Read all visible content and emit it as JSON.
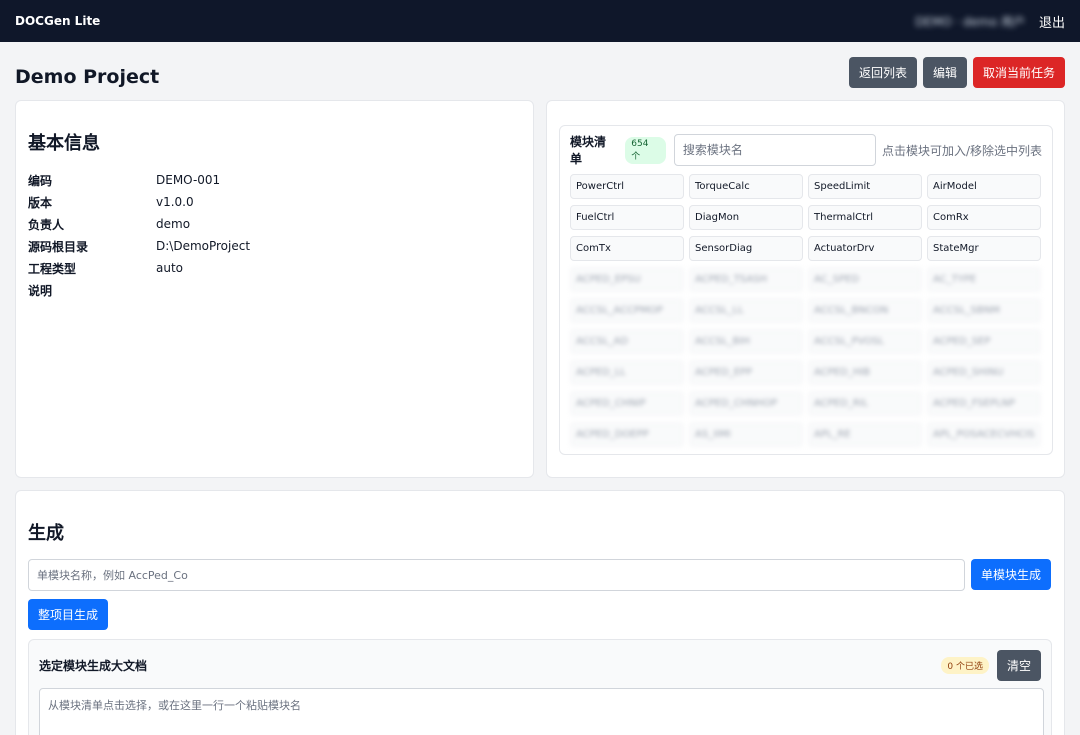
{
  "header": {
    "brand": "DOCGen Lite",
    "user": "DEMO · demo 用户",
    "logout": "退出"
  },
  "page": {
    "title": "Demo Project"
  },
  "actions": {
    "back": "返回列表",
    "edit": "编辑",
    "cancel_task": "取消当前任务"
  },
  "basic_info": {
    "title": "基本信息",
    "rows": [
      {
        "label": "编码",
        "value": "DEMO-001"
      },
      {
        "label": "版本",
        "value": "v1.0.0"
      },
      {
        "label": "负责人",
        "value": "demo"
      },
      {
        "label": "源码根目录",
        "value": "D:\\DemoProject"
      },
      {
        "label": "工程类型",
        "value": "auto"
      },
      {
        "label": "说明",
        "value": ""
      }
    ]
  },
  "modules": {
    "title": "模块清单",
    "count": "654 个",
    "search_placeholder": "搜索模块名",
    "hint": "点击模块可加入/移除选中列表",
    "items": [
      "PowerCtrl",
      "TorqueCalc",
      "SpeedLimit",
      "AirModel",
      "FuelCtrl",
      "DiagMon",
      "ThermalCtrl",
      "ComRx",
      "ComTx",
      "SensorDiag",
      "ActuatorDrv",
      "StateMgr"
    ],
    "blurred_items": [
      "ACPED_EPSU",
      "ACPED_TSASH",
      "AC_SPED",
      "AC_TYPE",
      "ACCSL_ACCPMOP",
      "ACCSL_LL",
      "ACCSL_BNCON",
      "ACCSL_SBNM",
      "ACCSL_AD",
      "ACCSL_BIH",
      "ACCSL_PVOSL",
      "ACPED_SEP",
      "ACPED_LL",
      "ACPED_EPP",
      "ACPED_HIB",
      "ACPED_SHINU",
      "ACPED_CHNIP",
      "ACPED_CHNHOP",
      "ACPED_RIL",
      "ACPED_FSEPLNP",
      "ACPED_DOEPP",
      "AS_IIMI",
      "APL_RE",
      "APL_POSACECVHCIS"
    ]
  },
  "generate": {
    "title": "生成",
    "single_placeholder": "单模块名称，例如 AccPed_Co",
    "single_button": "单模块生成",
    "project_button": "整项目生成",
    "selected": {
      "title": "选定模块生成大文档",
      "count": "0 个已选",
      "clear": "清空",
      "placeholder": "从模块清单点击选择，或在这里一行一个粘贴模块名"
    }
  }
}
